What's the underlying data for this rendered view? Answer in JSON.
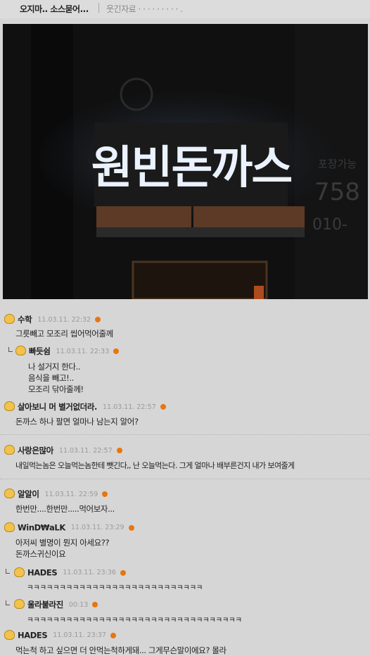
{
  "header": {
    "title": "오지마.. 소스묻어...",
    "category": "웃긴자료 · · · · · · · · · ."
  },
  "photo": {
    "sign_text": "원빈돈까스",
    "side_text_1": "포장가능",
    "side_text_2": "758",
    "side_text_3": "010-"
  },
  "comments": [
    {
      "nick": "수학",
      "time": "11.03.11. 22:32",
      "lines": [
        "그릇빼고 모조리 씹어먹어줄께"
      ]
    },
    {
      "nick": "빠듯쉼",
      "time": "11.03.11. 22:33",
      "lines": [
        "나 설거지 한다..",
        "음식을 빼고!..",
        "모조리 닦아줄께!"
      ]
    },
    {
      "nick": "살아보니 머 별거없더라.",
      "time": "11.03.11. 22:57",
      "lines": [
        "돈까스 하나 팔면 얼마나 남는지 알어?"
      ]
    },
    {
      "nick": "사랑은많아",
      "time": "11.03.11. 22:57",
      "lines": [
        "내일먹는놈은 오늘먹는놈한테 뺏긴다,, 난 오늘먹는다. 그게 얼마나 배부른건지 내가 보여줄게"
      ]
    },
    {
      "nick": "알알이",
      "time": "11.03.11. 22:59",
      "lines": [
        "한번만....한번만.....먹어보자..."
      ]
    },
    {
      "nick": "WinD₩aLK",
      "time": "11.03.11. 23:29",
      "lines": [
        "아저씨 별명이 뭔지 아세요??",
        "돈까스귀신이요"
      ]
    },
    {
      "nick": "HADES",
      "time": "11.03.11. 23:36",
      "lines": [
        "ㅋㅋㅋㅋㅋㅋㅋㅋㅋㅋㅋㅋㅋㅋㅋㅋㅋㅋㅋㅋㅋㅋㅋㅋㅋㅋㅋ"
      ]
    },
    {
      "nick": "울라불라진",
      "time": "00:13",
      "lines": [
        "ㅋㅋㅋㅋㅋㅋㅋㅋㅋㅋㅋㅋㅋㅋㅋㅋㅋㅋㅋㅋㅋㅋㅋㅋㅋㅋㅋㅋㅋㅋㅋㅋㅋ"
      ]
    },
    {
      "nick": "HADES",
      "time": "11.03.11. 23:37",
      "lines": [
        "먹는척 하고 싶으면 더 안먹는척하게돼... 그게무슨말이에요? 몰라"
      ]
    }
  ]
}
